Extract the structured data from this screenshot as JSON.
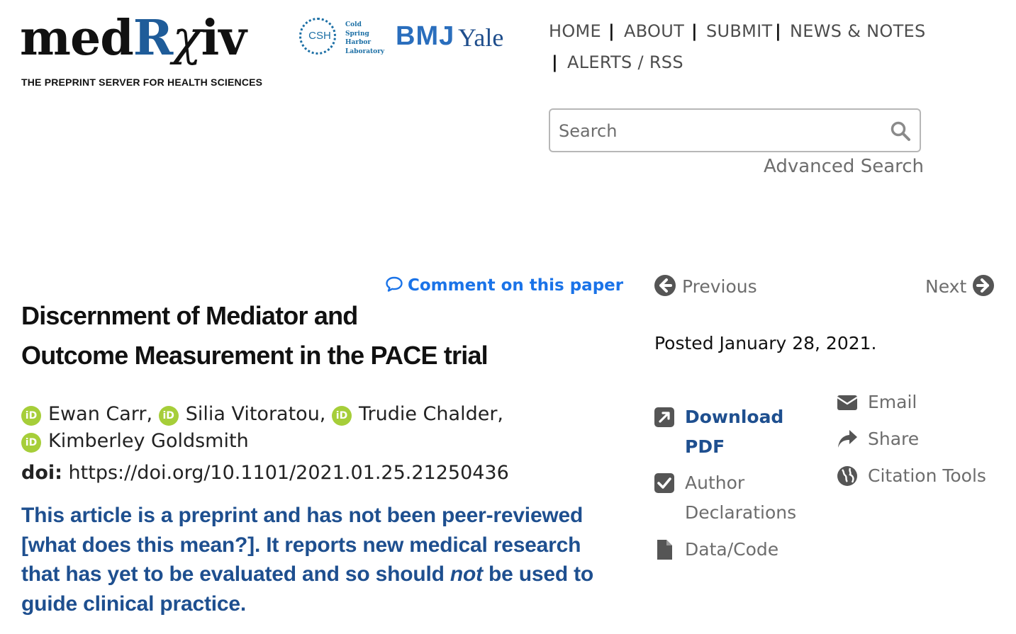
{
  "logo": {
    "name_med": "med",
    "name_r": "R",
    "name_x": "χ",
    "name_iv": "iv",
    "tagline": "THE PREPRINT SERVER FOR HEALTH SCIENCES"
  },
  "partners": {
    "csh_abbr": "CSH",
    "csh_line1": "Cold",
    "csh_line2": "Spring",
    "csh_line3": "Harbor",
    "csh_line4": "Laboratory",
    "bmj": "BMJ",
    "yale": "Yale"
  },
  "nav": {
    "home": "HOME",
    "about": "ABOUT",
    "submit": "SUBMIT",
    "news": "NEWS & NOTES",
    "alerts": "ALERTS / RSS",
    "separator": "|"
  },
  "search": {
    "placeholder": "Search",
    "value": "",
    "advanced": "Advanced Search"
  },
  "comment_link": "Comment on this paper",
  "article": {
    "title_line1": "Discernment of Mediator and",
    "title_line2": "Outcome Measurement in the PACE trial",
    "authors": [
      {
        "name": "Ewan Carr,"
      },
      {
        "name": "Silia Vitoratou,"
      },
      {
        "name": "Trudie Chalder,"
      },
      {
        "name": "Kimberley Goldsmith"
      }
    ],
    "orcid_label": "iD",
    "doi_label": "doi:",
    "doi": "https://doi.org/10.1101/2021.01.25.21250436",
    "notice_part1": "This article is a preprint and has not been peer-reviewed [what does this mean?]. It reports new medical research that has yet to be evaluated and so should ",
    "notice_not": "not",
    "notice_part2": " be used to guide clinical practice."
  },
  "sidebar": {
    "previous": "Previous",
    "next": "Next",
    "posted": "Posted January 28, 2021.",
    "download_pdf": "Download PDF",
    "author_declarations": "Author Declarations",
    "data_code": "Data/Code",
    "email": "Email",
    "share": "Share",
    "citation_tools": "Citation Tools"
  },
  "colors": {
    "brand_blue": "#1e4f8f",
    "link_blue": "#1a73e8",
    "orcid_green": "#a6ce39",
    "muted_gray": "#6d6d6d"
  },
  "icons": [
    "search-icon",
    "comment-icon",
    "arrow-left-circle-icon",
    "arrow-right-circle-icon",
    "external-link-icon",
    "checkbox-icon",
    "file-icon",
    "envelope-icon",
    "share-arrow-icon",
    "globe-icon",
    "orcid-icon"
  ]
}
